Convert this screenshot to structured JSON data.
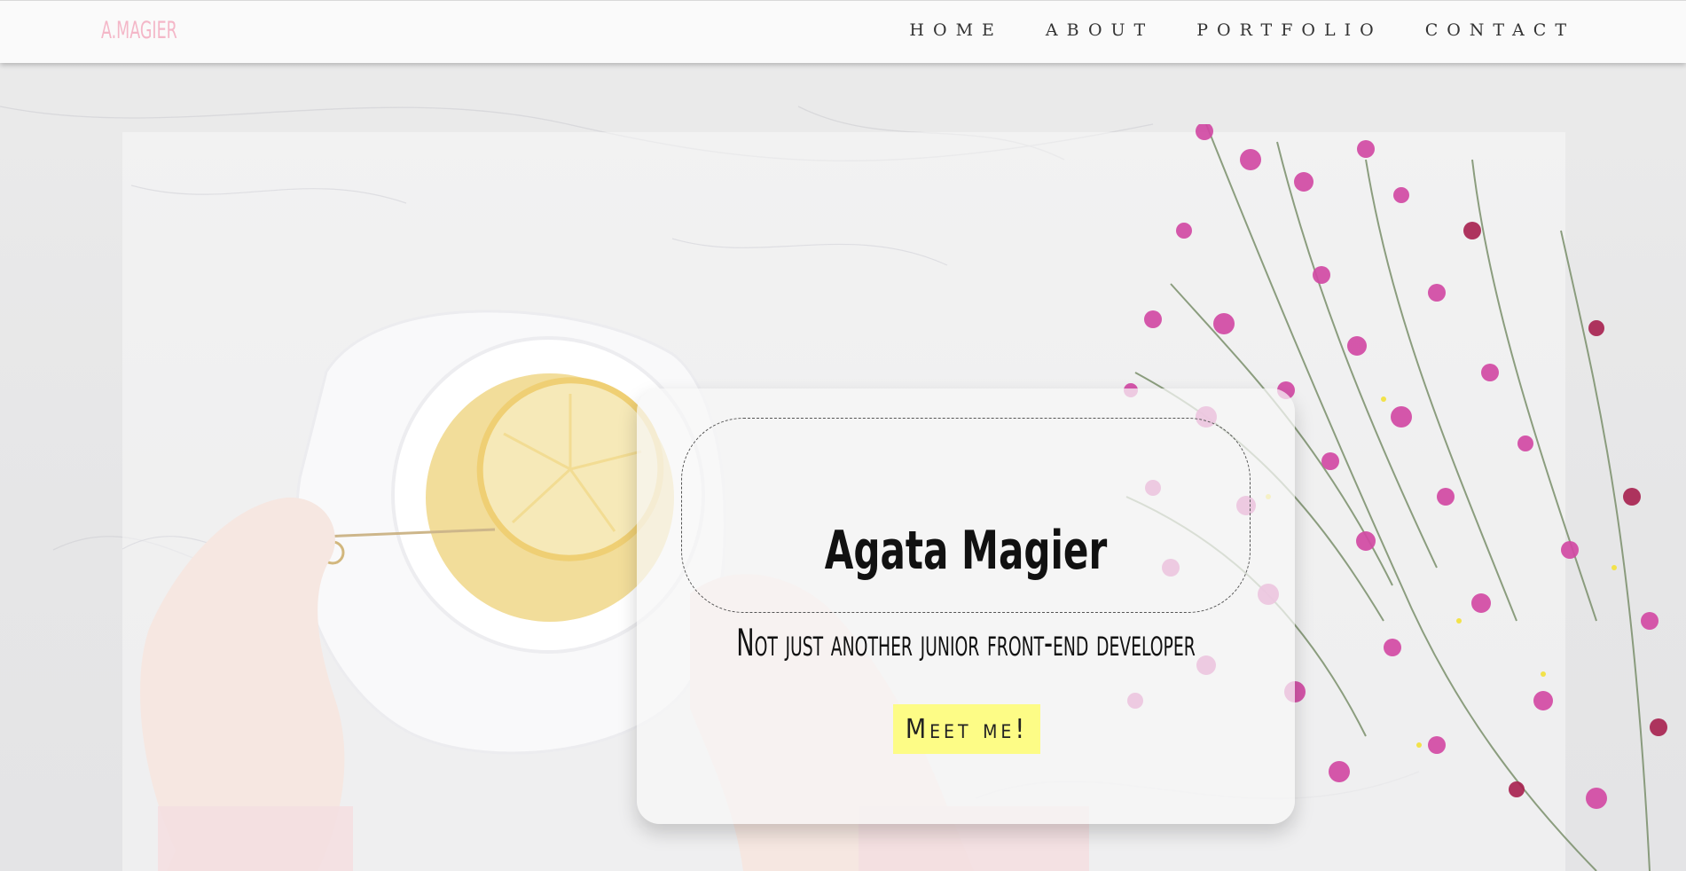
{
  "header": {
    "logo": "A.MAGIER",
    "nav": [
      {
        "label": "HOME"
      },
      {
        "label": "ABOUT"
      },
      {
        "label": "PORTFOLIO"
      },
      {
        "label": "CONTACT"
      }
    ]
  },
  "hero": {
    "name": "Agata Magier",
    "tagline": "Not just another junior front-end developer",
    "cta_label": "Meet me!"
  },
  "colors": {
    "logo": "#f4b7c8",
    "cta_background": "#fdfc86",
    "text": "#111111",
    "flowers": "#d64aa8"
  },
  "icons": [
    "tea-cup-image",
    "flowers-image",
    "hands-image"
  ]
}
